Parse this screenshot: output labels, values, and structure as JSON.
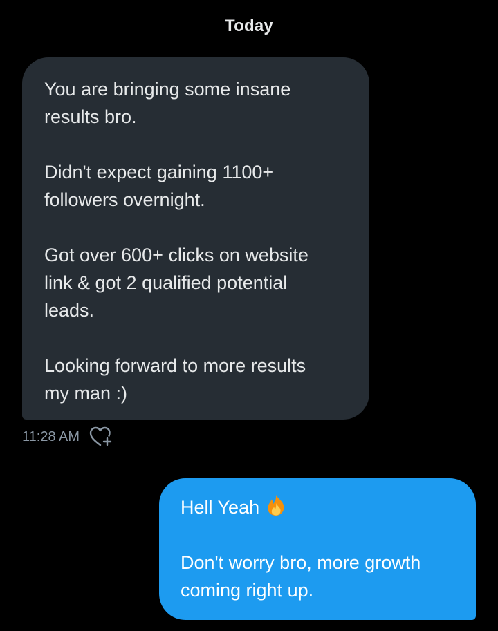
{
  "conversation": {
    "date_label": "Today",
    "received": {
      "paragraphs": [
        "You are bringing some insane\nresults bro.",
        "Didn't expect gaining 1100+\nfollowers overnight.",
        "Got over 600+ clicks on website\nlink & got 2 qualified potential\nleads.",
        "Looking forward to more results\nmy man :)"
      ],
      "timestamp": "11:28 AM",
      "react_icon": "heart-plus-icon"
    },
    "sent": {
      "greeting": "Hell Yeah",
      "emoji": "fire-emoji",
      "body": "Don't worry bro, more growth\ncoming right up."
    }
  },
  "colors": {
    "background": "#000000",
    "received_bubble": "#262d34",
    "sent_bubble": "#1d9bf0",
    "text": "#e7e9ea",
    "secondary_text": "#8b98a5"
  }
}
